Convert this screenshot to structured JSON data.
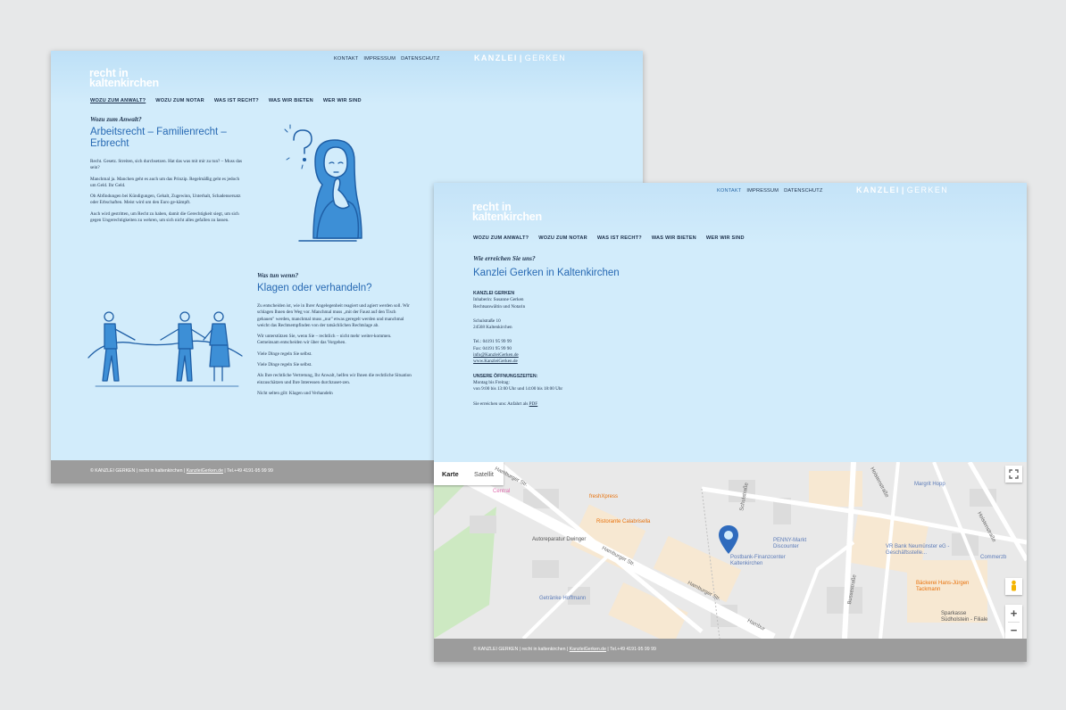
{
  "page1": {
    "toplinks": [
      "KONTAKT",
      "IMPRESSUM",
      "DATENSCHUTZ"
    ],
    "brand_a": "KANZLEI",
    "brand_b": "GERKEN",
    "logo_line1": "recht in",
    "logo_line2": "kaltenkirchen",
    "nav": [
      "WOZU ZUM ANWALT?",
      "WOZU ZUM NOTAR",
      "WAS IST RECHT?",
      "WAS WIR BIETEN",
      "WER WIR SIND"
    ],
    "section1": {
      "kicker": "Wozu zum Anwalt?",
      "title_line1": "Arbeitsrecht – Familienrecht –",
      "title_line2": "Erbrecht",
      "paragraphs": [
        "Recht. Gesetz. Streiten, sich durchsetzen. Hat das was mit mir zu tun? – Muss das sein?",
        "Manchmal ja. Manchen geht es auch um das Prinzip. Regelmäßig geht es jedoch um Geld. Ihr Geld.",
        "Ob Abfindungen bei Kündigungen, Gehalt, Zugewinn, Unterhalt, Schadensersatz oder Erbschaften. Meist wird um den Euro ge-kämpft.",
        "Auch wird gestritten, um Recht zu haben, damit die Gerechtigkeit siegt, um sich gegen Ungerechtigkeiten zu wehren, um sich nicht alles gefallen zu lassen."
      ]
    },
    "section2": {
      "kicker": "Was tun wenn?",
      "title": "Klagen oder verhandeln?",
      "paragraphs": [
        "Zu entscheiden ist, wie in Ihrer Angelegenheit reagiert und agiert werden soll. Wir schlagen Ihnen den Weg vor. Manchmal muss „mit der Faust auf den Tisch gehauen\" werden, manchmal muss „nur\" etwas geregelt werden und manchmal weicht das Rechtsempfinden von der tatsächlichen Rechtslage ab.",
        "Wir unterstützen Sie, wenn Sie – rechtlich – nicht mehr weiter-kommen. Gemeinsam entscheiden wir über das Vorgehen.",
        "Viele Dinge regeln Sie selbst.",
        "Viele Dinge regeln Sie selbst.",
        "Als Ihre rechtliche Vertretung, Ihr Anwalt, helfen wir Ihnen die rechtliche Situation einzuschätzen und Ihre Interessen durchzuset-zen.",
        "Nicht selten gilt: Klagen und Verhandeln"
      ]
    },
    "footer": {
      "text": "© KANZLEI GERKEN | recht in kaltenkirchen | ",
      "link": "KanzleiGerken.de",
      "tel": " | Tel.+49 4191-95 99 99"
    }
  },
  "page2": {
    "toplinks": [
      "KONTAKT",
      "IMPRESSUM",
      "DATENSCHUTZ"
    ],
    "brand_a": "KANZLEI",
    "brand_b": "GERKEN",
    "logo_line1": "recht in",
    "logo_line2": "kaltenkirchen",
    "nav": [
      "WOZU ZUM ANWALT?",
      "WOZU ZUM NOTAR",
      "WAS IST RECHT?",
      "WAS WIR BIETEN",
      "WER WIR SIND"
    ],
    "kicker": "Wie erreichen Sie uns?",
    "title": "Kanzlei Gerken in Kaltenkirchen",
    "contact": {
      "company": "KANZLEI GERKEN",
      "owner": "Inhaberin: Susanne Gerken",
      "role": "Rechtsanwältin und Notarin",
      "street": "Schulstraße 10",
      "city": "24568 Kaltenkirchen",
      "tel": "Tel.: 04191 95 99 99",
      "fax": "Fax: 04191 95 99 90",
      "email": "info@KanzleiGerken.de",
      "web": "www.KanzleiGerken.de",
      "hours_title": "UNSERE ÖFFNUNGSZEITEN:",
      "hours_days": "Montag bis Freitag:",
      "hours_time": "von 9:00 bis 13:00 Uhr und 14:00 bis 18:00 Uhr",
      "directions_text": "Sie erreichen uns: Anfahrt als ",
      "directions_link": "PDF"
    },
    "map": {
      "tab_map": "Karte",
      "tab_satellite": "Satellit",
      "pois": [
        "Central",
        "freshXpress",
        "Ristorante Calabrisella",
        "Autoreparatur Dwinger",
        "Getränke Hoffmann",
        "PENNY-Markt Discounter",
        "Postbank-Finanzcenter Kaltenkirchen",
        "Margrit Hopp",
        "VR Bank Neumünster eG - Geschäftsstelle...",
        "Commerzb",
        "Bäckerei Hans-Jürgen Tackmann",
        "Sparkasse Südholstein - Filiale"
      ],
      "roads": [
        "Hamburger Str.",
        "Hamburger Str.",
        "Hamburger Str.",
        "Hambur",
        "Schulstraße",
        "Holstenstraße",
        "Holstenstraße",
        "Bussestraße"
      ],
      "zoom_in": "+",
      "zoom_out": "−"
    },
    "footer": {
      "text": "© KANZLEI GERKEN | recht in kaltenkirchen | ",
      "link": "KanzleiGerken.de",
      "tel": " | Tel.+49 4191-95 99 99"
    }
  },
  "colors": {
    "page_bg": "#d2ecfb",
    "accent": "#2769b3",
    "text": "#1b2f4a",
    "footer": "#9c9c9c",
    "illustration": "#3d8fd6"
  }
}
